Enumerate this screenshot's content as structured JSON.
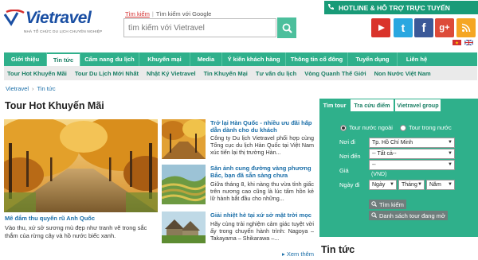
{
  "header": {
    "logo_text": "Vietravel",
    "logo_sub": "NHÀ TỔ CHỨC DU LỊCH CHUYÊN NGHIỆP",
    "search_tabs": [
      "Tìm kiếm",
      "Tìm kiếm với Google"
    ],
    "search_placeholder": "tìm kiếm với Vietravel",
    "hotline": "HOTLINE & HỖ TRỢ TRỰC TUYẾN",
    "social": [
      "youtube-icon",
      "twitter-icon",
      "facebook-icon",
      "google-plus-icon",
      "rss-icon"
    ]
  },
  "nav": {
    "items": [
      "Giới thiệu",
      "Tin tức",
      "Cẩm nang du lịch",
      "Khuyến mại",
      "Media",
      "Ý kiến khách hàng",
      "Thông tin cổ đông",
      "Tuyển dụng",
      "Liên hệ"
    ],
    "active_index": 1
  },
  "subnav": {
    "items": [
      "Tour Hot Khuyến Mãi",
      "Tour Du Lịch Mới Nhất",
      "Nhật Ký Vietravel",
      "Tin Khuyến Mại",
      "Tư vấn du lịch",
      "Vòng Quanh Thế Giới",
      "Non Nước Việt Nam"
    ]
  },
  "breadcrumb": [
    "Vietravel",
    "Tin tức"
  ],
  "section_title": "Tour Hot Khuyến Mãi",
  "featured": {
    "title": "Mê đắm thu quyến rũ Anh Quốc",
    "desc": "Vào thu, xứ sở sương mù đẹp như tranh vẽ trong sắc thắm của rừng cây và hồ nước biếc xanh."
  },
  "news": [
    {
      "title": "Trở lại Hàn Quốc - nhiều ưu đãi hấp dẫn dành cho du khách",
      "desc": "Công ty Du lịch Vietravel phối hợp cùng Tổng cục du lịch Hàn Quốc tại Việt Nam xúc tiến lại thị trường Hàn..."
    },
    {
      "title": "Săn ảnh cung đường vàng phương Bắc, bạn đã sẵn sàng chưa",
      "desc": "Giữa tháng 8, khi nàng thu vừa tỉnh giấc trên nương cao cũng là lúc tấm hồn kẻ lữ hành bắt đầu cho những..."
    },
    {
      "title": "Giải nhiệt hè tại xứ sở mặt trời mọc",
      "desc": "Hãy cùng trải nghiệm cảm giác tuyệt vời ấy trong chuyến hành trình: Nagoya – Takayama – Shikarawa –..."
    }
  ],
  "more_link": "Xem thêm",
  "panel": {
    "tabs": [
      "Tìm tour",
      "Tra cứu điểm",
      "Vietravel group"
    ],
    "radio": [
      "Tour nước ngoài",
      "Tour trong nước"
    ],
    "radio_selected": 0,
    "labels": [
      "Nơi đi",
      "Nơi đến",
      "Giá",
      "Ngày đi"
    ],
    "noi_di": "Tp. Hồ Chí Minh",
    "noi_den": "-- Tất cả--",
    "gia": "--",
    "vnd": "(VND)",
    "ngay": "Ngày",
    "thang": "Tháng",
    "nam": "Năm",
    "btn_search": "Tìm kiếm",
    "btn_list": "Danh sách tour đang mở"
  },
  "tin_tuc": "Tin tức",
  "colors": {
    "brand_green": "#2fb08b",
    "link_blue": "#1a6ea8",
    "logo_blue": "#1a4fa3"
  }
}
